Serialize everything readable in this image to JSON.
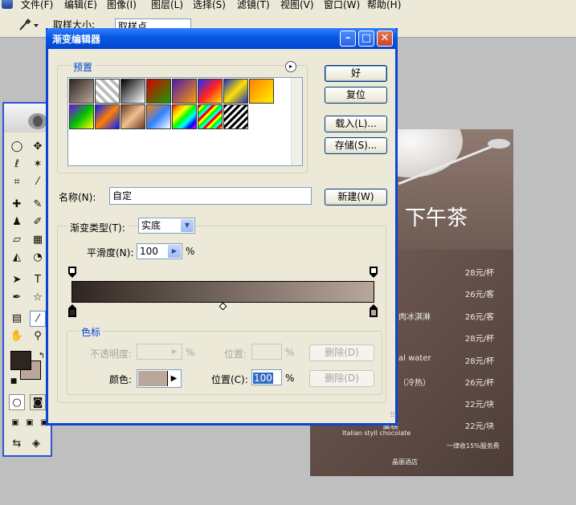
{
  "menubar": {
    "items": [
      "文件(F)",
      "编辑(E)",
      "图像(I)",
      "图层(L)",
      "选择(S)",
      "滤镜(T)",
      "视图(V)",
      "窗口(W)",
      "帮助(H)"
    ]
  },
  "options": {
    "sample_label": "取样大小:",
    "sample_value": "取样点"
  },
  "dialog": {
    "title": "渐变编辑器",
    "presets_label": "预置",
    "buttons": {
      "ok": "好",
      "reset": "复位",
      "load": "载入(L)...",
      "save": "存储(S)...",
      "new": "新建(W)"
    },
    "name_label": "名称(N):",
    "name_value": "自定",
    "gradient_type_label": "渐变类型(T):",
    "gradient_type_value": "实底",
    "smoothness_label": "平滑度(N):",
    "smoothness_value": "100",
    "percent": "%",
    "color_stops": {
      "group_label": "色标",
      "opacity_label": "不透明度:",
      "position_label_top": "位置:",
      "delete_label_top": "删除(D)",
      "color_label": "颜色:",
      "position_label": "位置(C):",
      "position_value": "100",
      "delete_label": "删除(D)"
    },
    "gradient": {
      "start_color": "#2f2520",
      "end_color": "#b9a79c"
    }
  },
  "document": {
    "title": "下午茶",
    "prices": [
      "28元/杯",
      "26元/客",
      "26元/客",
      "28元/杯",
      "28元/杯",
      "26元/杯",
      "22元/块",
      "22元/块"
    ],
    "dish_fragments": [
      "肉冰淇淋",
      "al water",
      "（冷热）",
      "蛋糕"
    ],
    "subtitle": "Italian styll chocolate",
    "note": "一律收15%服务费",
    "logo": "晶丽酒店"
  },
  "toolbox": {
    "foreground": "#2f2520",
    "background": "#b9a79c"
  }
}
